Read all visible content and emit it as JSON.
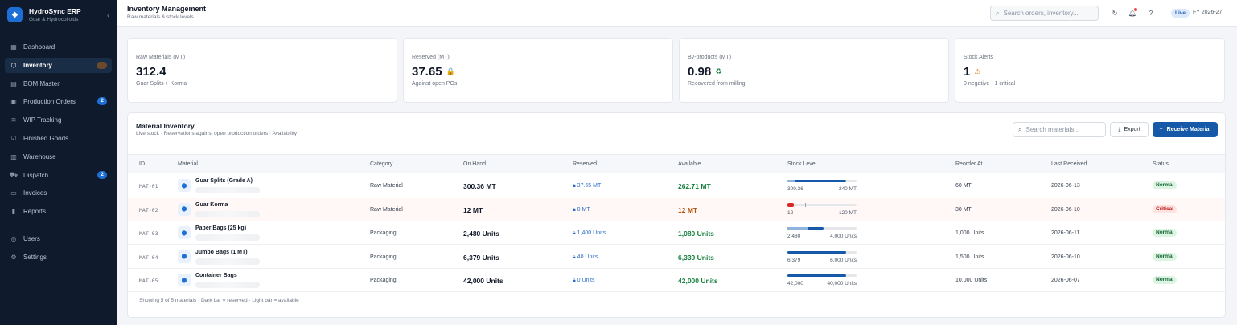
{
  "brand": {
    "title": "HydroSync ERP",
    "subtitle": "Guar & Hydrocolloids",
    "collapse_glyph": "‹"
  },
  "sidebar": {
    "items": [
      {
        "label": "Dashboard",
        "icon": "grid-icon"
      },
      {
        "label": "Inventory",
        "icon": "box-icon",
        "active": true
      },
      {
        "label": "BOM Master",
        "icon": "book-icon"
      },
      {
        "label": "Production Orders",
        "icon": "clipboard-icon",
        "badge": "2"
      },
      {
        "label": "WIP Tracking",
        "icon": "layers-icon"
      },
      {
        "label": "Finished Goods",
        "icon": "check-box-icon"
      },
      {
        "label": "Warehouse",
        "icon": "building-icon"
      },
      {
        "label": "Dispatch",
        "icon": "truck-icon",
        "badge": "2"
      },
      {
        "label": "Invoices",
        "icon": "file-icon"
      },
      {
        "label": "Reports",
        "icon": "chart-icon"
      }
    ],
    "secondary": [
      {
        "label": "Users",
        "icon": "users-icon"
      },
      {
        "label": "Settings",
        "icon": "gear-icon"
      }
    ]
  },
  "header": {
    "title": "Inventory Management",
    "subtitle": "Raw materials & stock levels",
    "search_placeholder": "Search orders, inventory...",
    "live_label": "Live",
    "fy_label": "FY 2026-27"
  },
  "stats": [
    {
      "label": "Raw Materials (MT)",
      "value": "312.4",
      "sub": "Guar Splits + Korma",
      "icon": ""
    },
    {
      "label": "Reserved (MT)",
      "value": "37.65",
      "sub": "Against open POs",
      "icon": "lock-icon",
      "glyph": "🔒",
      "color": "#2b6cc4"
    },
    {
      "label": "By-products (MT)",
      "value": "0.98",
      "sub": "Recovered from milling",
      "icon": "recycle-icon",
      "glyph": "♻",
      "color": "#15803d"
    },
    {
      "label": "Stock Alerts",
      "value": "1",
      "sub": "0 negative · 1 critical",
      "icon": "warning-icon",
      "glyph": "⚠",
      "color": "#d97706"
    }
  ],
  "panel": {
    "title": "Material Inventory",
    "subtitle": "Live stock · Reservations against open production orders · Availability",
    "search_placeholder": "Search materials...",
    "export_label": "Export",
    "receive_label": "Receive Material",
    "columns": [
      "ID",
      "Material",
      "Category",
      "On Hand",
      "Reserved",
      "Available",
      "Stock Level",
      "Reorder At",
      "Last Received",
      "Status"
    ],
    "rows": [
      {
        "id": "MAT-01",
        "material": "Guar Splits (Grade A)",
        "category": "Raw Material",
        "on_hand": "300.36 MT",
        "reserved": "37.65 MT",
        "available": "262.71 MT",
        "level_left": "300.36",
        "level_right": "240 MT",
        "reserved_fraction": 0.13,
        "available_fraction": 0.87,
        "reorder": "60 MT",
        "last_received": "2026-06-13",
        "status": "Normal",
        "status_type": "ok"
      },
      {
        "id": "MAT-02",
        "material": "Guar Korma",
        "category": "Raw Material",
        "on_hand": "12 MT",
        "reserved": "0 MT",
        "available": "12 MT",
        "level_left": "12",
        "level_right": "120 MT",
        "reserved_fraction": 0,
        "available_fraction": 0.1,
        "reorder": "30 MT",
        "last_received": "2026-06-10",
        "status": "Critical",
        "status_type": "crit"
      },
      {
        "id": "MAT-03",
        "material": "Paper Bags (25 kg)",
        "category": "Packaging",
        "on_hand": "2,480 Units",
        "reserved": "1,400 Units",
        "available": "1,080 Units",
        "level_left": "2,480",
        "level_right": "4,000 Units",
        "reserved_fraction": 0.35,
        "available_fraction": 0.27,
        "reorder": "1,000 Units",
        "last_received": "2026-06-11",
        "status": "Normal",
        "status_type": "ok"
      },
      {
        "id": "MAT-04",
        "material": "Jumbo Bags (1 MT)",
        "category": "Packaging",
        "on_hand": "6,379 Units",
        "reserved": "40 Units",
        "available": "6,339 Units",
        "level_left": "6,379",
        "level_right": "6,000 Units",
        "reserved_fraction": 0.01,
        "available_fraction": 0.99,
        "reorder": "1,500 Units",
        "last_received": "2026-06-10",
        "status": "Normal",
        "status_type": "ok"
      },
      {
        "id": "MAT-05",
        "material": "Container Bags",
        "category": "Packaging",
        "on_hand": "42,000 Units",
        "reserved": "0 Units",
        "available": "42,000 Units",
        "level_left": "42,000",
        "level_right": "40,000 Units",
        "reserved_fraction": 0,
        "available_fraction": 1,
        "reorder": "10,000 Units",
        "last_received": "2026-06-07",
        "status": "Normal",
        "status_type": "ok"
      }
    ],
    "footer": "Showing 5 of 5 materials · Dark bar = reserved · Light bar = available"
  }
}
